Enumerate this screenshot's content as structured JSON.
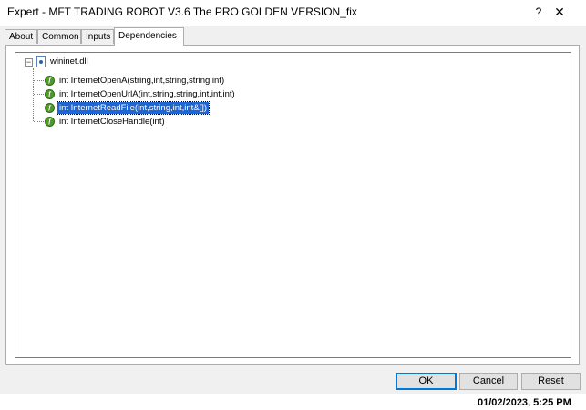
{
  "window": {
    "title": "Expert - MFT TRADING ROBOT V3.6 The PRO GOLDEN VERSION_fix",
    "help_label": "?",
    "close_label": "✕"
  },
  "tabs": [
    {
      "label": "About",
      "active": false
    },
    {
      "label": "Common",
      "active": false
    },
    {
      "label": "Inputs",
      "active": false
    },
    {
      "label": "Dependencies",
      "active": true
    }
  ],
  "tree": {
    "expander_label": "−",
    "root": {
      "label": "wininet.dll",
      "icon": "dll-file-icon",
      "expanded": true,
      "children": [
        {
          "label": "int InternetOpenA(string,int,string,string,int)",
          "icon": "function-icon",
          "selected": false
        },
        {
          "label": "int InternetOpenUrlA(int,string,string,int,int,int)",
          "icon": "function-icon",
          "selected": false
        },
        {
          "label": "int InternetReadFile(int,string,int,int&[])",
          "icon": "function-icon",
          "selected": true
        },
        {
          "label": "int InternetCloseHandle(int)",
          "icon": "function-icon",
          "selected": false
        }
      ]
    }
  },
  "buttons": {
    "ok": "OK",
    "cancel": "Cancel",
    "reset": "Reset"
  },
  "footer": {
    "timestamp": "01/02/2023, 5:25 PM"
  },
  "colors": {
    "selection": "#1e66d4",
    "function_icon": "#4f9a2a",
    "default_button_border": "#0078d7"
  }
}
